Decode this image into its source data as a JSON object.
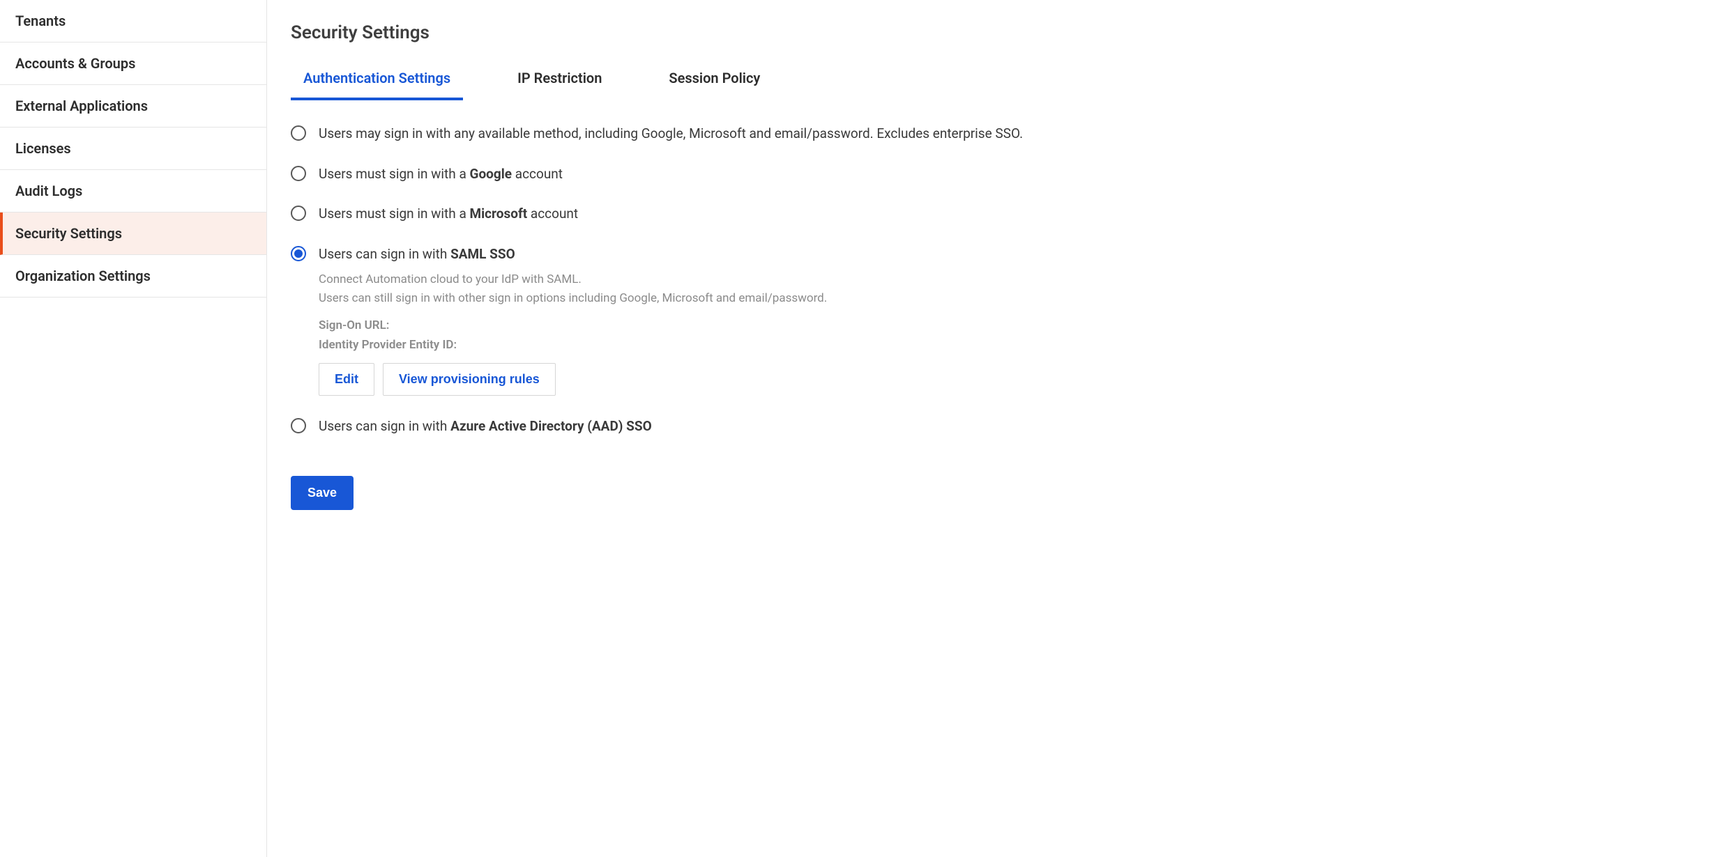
{
  "sidebar": {
    "items": [
      {
        "label": "Tenants",
        "active": false
      },
      {
        "label": "Accounts & Groups",
        "active": false
      },
      {
        "label": "External Applications",
        "active": false
      },
      {
        "label": "Licenses",
        "active": false
      },
      {
        "label": "Audit Logs",
        "active": false
      },
      {
        "label": "Security Settings",
        "active": true
      },
      {
        "label": "Organization Settings",
        "active": false
      }
    ]
  },
  "main": {
    "title": "Security Settings",
    "tabs": [
      {
        "label": "Authentication Settings",
        "active": true
      },
      {
        "label": "IP Restriction",
        "active": false
      },
      {
        "label": "Session Policy",
        "active": false
      }
    ],
    "options": {
      "any": {
        "text": "Users may sign in with any available method, including Google, Microsoft and email/password. Excludes enterprise SSO."
      },
      "google": {
        "prefix": "Users must sign in with a ",
        "bold": "Google",
        "suffix": " account"
      },
      "microsoft": {
        "prefix": "Users must sign in with a ",
        "bold": "Microsoft",
        "suffix": " account"
      },
      "saml": {
        "prefix": "Users can sign in with ",
        "bold": "SAML SSO",
        "desc1": "Connect Automation cloud to your IdP with SAML.",
        "desc2": "Users can still sign in with other sign in options including Google, Microsoft and email/password.",
        "signon_label": "Sign-On URL:",
        "entity_label": "Identity Provider Entity ID:",
        "edit_btn": "Edit",
        "rules_btn": "View provisioning rules"
      },
      "aad": {
        "prefix": "Users can sign in with ",
        "bold": "Azure Active Directory (AAD) SSO"
      }
    },
    "save_button": "Save"
  }
}
